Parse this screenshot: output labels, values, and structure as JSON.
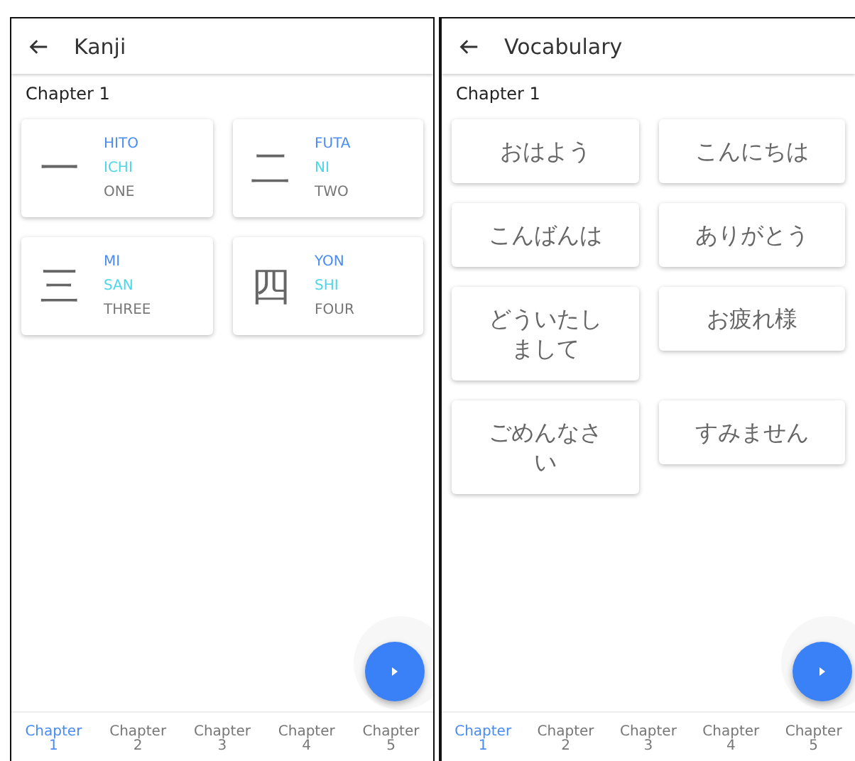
{
  "screens": [
    {
      "kind": "kanji",
      "title": "Kanji",
      "section": "Chapter 1",
      "cards": [
        {
          "character": "一",
          "kun": "HITO",
          "on": "ICHI",
          "meaning": "ONE"
        },
        {
          "character": "二",
          "kun": "FUTA",
          "on": "NI",
          "meaning": "TWO"
        },
        {
          "character": "三",
          "kun": "MI",
          "on": "SAN",
          "meaning": "THREE"
        },
        {
          "character": "四",
          "kun": "YON",
          "on": "SHI",
          "meaning": "FOUR"
        }
      ],
      "tabs": [
        {
          "label": "Chapter 1",
          "selected": true
        },
        {
          "label": "Chapter 2",
          "selected": false
        },
        {
          "label": "Chapter 3",
          "selected": false
        },
        {
          "label": "Chapter 4",
          "selected": false
        },
        {
          "label": "Chapter 5",
          "selected": false
        }
      ]
    },
    {
      "kind": "vocabulary",
      "title": "Vocabulary",
      "section": "Chapter 1",
      "cards": [
        {
          "text": "おはよう"
        },
        {
          "text": "こんにちは"
        },
        {
          "text": "こんばんは"
        },
        {
          "text": "ありがとう"
        },
        {
          "text": "どういたしまして"
        },
        {
          "text": "お疲れ様"
        },
        {
          "text": "ごめんなさい"
        },
        {
          "text": "すみません"
        }
      ],
      "tabs": [
        {
          "label": "Chapter 1",
          "selected": true
        },
        {
          "label": "Chapter 2",
          "selected": false
        },
        {
          "label": "Chapter 3",
          "selected": false
        },
        {
          "label": "Chapter 4",
          "selected": false
        },
        {
          "label": "Chapter 5",
          "selected": false
        }
      ]
    }
  ]
}
